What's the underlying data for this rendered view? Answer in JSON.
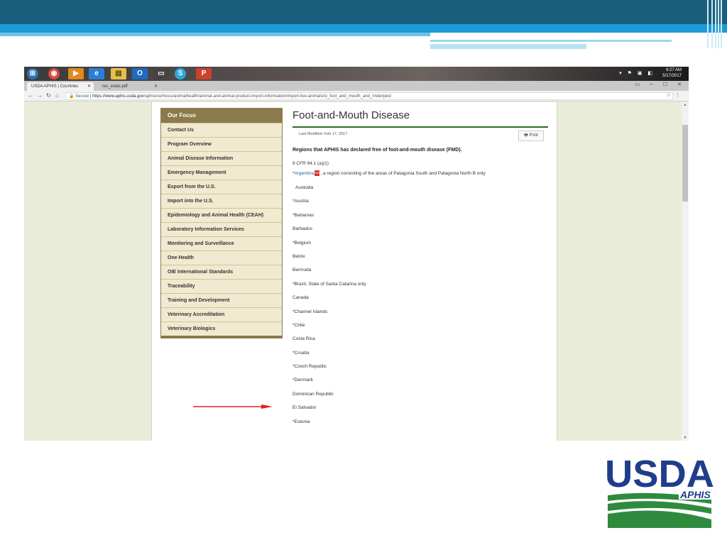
{
  "taskbar": {
    "icons": [
      "start-icon",
      "chrome-icon",
      "media-player-icon",
      "internet-explorer-icon",
      "file-explorer-icon",
      "outlook-icon",
      "terminal-icon",
      "skype-icon",
      "powerpoint-icon"
    ],
    "clock_time": "9:27 AM",
    "clock_date": "5/17/2017"
  },
  "browser": {
    "tabs": [
      {
        "label": "USDA APHIS | Countries"
      },
      {
        "label": "res_evals.pdf"
      }
    ],
    "url_secure": "Secure",
    "url_domain": "https://www.aphis.usda.gov",
    "url_path": "/aphis/ourfocus/animalhealth/animal-and-animal-product-import-information/import-live-animals/ct_foot_and_mouth_and_rinderpest"
  },
  "sidenav": {
    "heading": "Our Focus",
    "items": [
      "Contact Us",
      "Program Overview",
      "Animal Disease Information",
      "Emergency Management",
      "Export from the U.S.",
      "Import into the U.S.",
      "Epidemiology and Animal Health (CEAH)",
      "Laboratory Information Services",
      "Monitoring and Surveillance",
      "One Health",
      "OIE International Standards",
      "Traceability",
      "Training and Development",
      "Veterinary Accreditation",
      "Veterinary Biologics"
    ]
  },
  "content": {
    "title": "Foot-and-Mouth Disease",
    "last_modified": "Last Modified: Feb 17, 2017",
    "print_label": "Print",
    "lead": "Regions that APHIS has declared free of foot-and-mouth disease (FMD).",
    "reference": "9 CFR 94.1 (a)(1)",
    "argentina_star": "*",
    "argentina_link": "Argentina",
    "argentina_note": ", a region consisting of the areas of Patagonia South and Patagonia North B only",
    "countries": [
      "Australia",
      "*Austria",
      "*Bahamas",
      "Barbados",
      "*Belgium",
      "Belize",
      "Bermuda",
      "*Brazil, State of Santa Catarina only",
      "Canada",
      "*Channel Islands",
      "*Chile",
      "Costa Rica",
      "*Croatia",
      "*Czech Republic",
      "*Denmark",
      "Dominican Republic",
      "El Salvador",
      "*Estonia"
    ]
  },
  "logo": {
    "wordmark": "USDA",
    "subtext": "APHIS"
  },
  "colors": {
    "slide_dark_blue": "#1a5f7e",
    "slide_bright_blue": "#1e9bd7",
    "nav_heading": "#8a7a4c",
    "title_rule": "#2c6e1e",
    "arrow": "#e02020",
    "usda_blue": "#1f3d8a",
    "usda_green": "#2e8b3e"
  }
}
